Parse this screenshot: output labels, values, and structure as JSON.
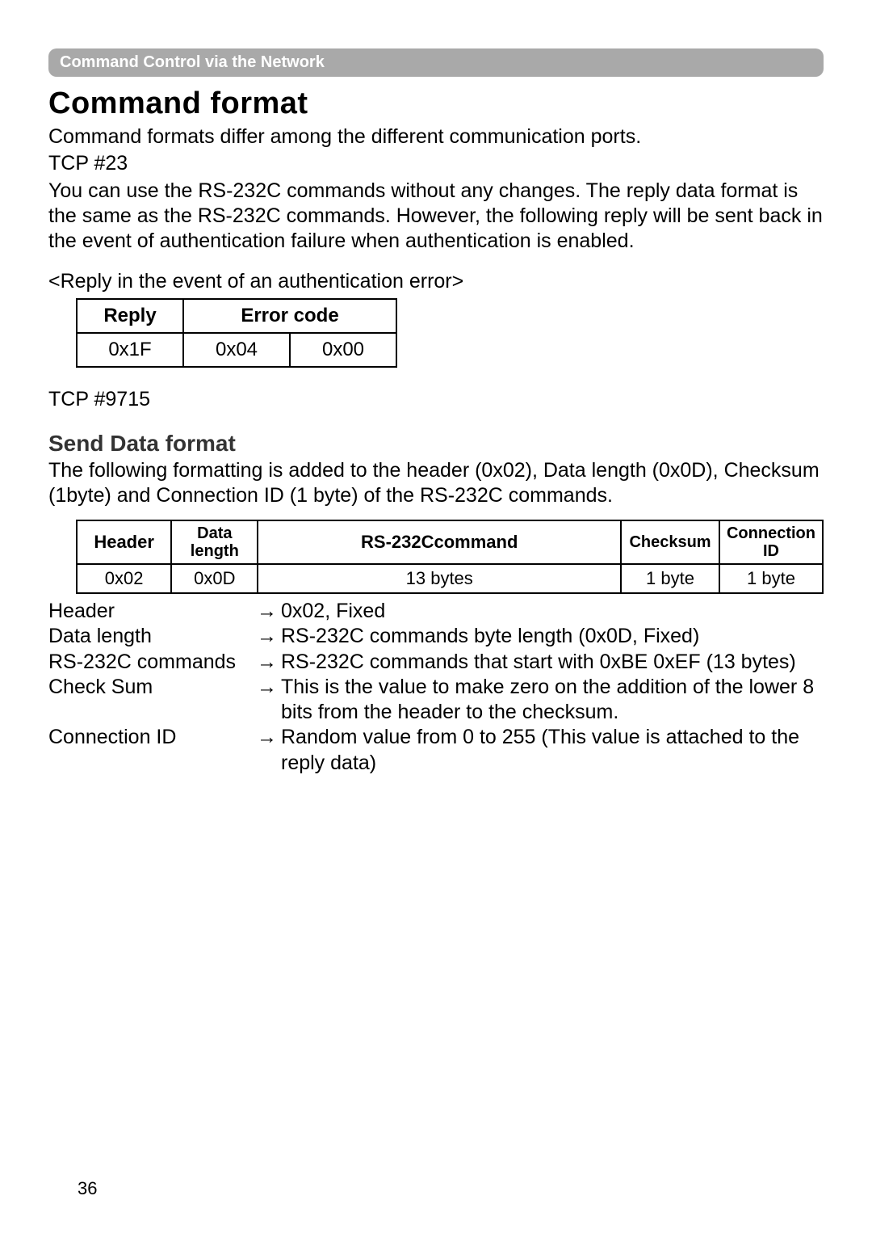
{
  "breadcrumb": "Command Control via the Network",
  "h1": "Command format",
  "intro1": "Command formats differ among the different communication ports.",
  "tcp23": "TCP #23",
  "intro2": "You can use the RS-232C commands without any changes. The reply data format is the same as the RS-232C commands. However, the following reply will be sent back in the event of authentication failure when authentication is enabled.",
  "caption_auth": "<Reply in the event of an authentication error>",
  "table1": {
    "h_reply": "Reply",
    "h_error": "Error code",
    "v_reply": "0x1F",
    "v_err1": "0x04",
    "v_err2": "0x00"
  },
  "tcp9715": "TCP #9715",
  "h2": "Send Data format",
  "senddesc": "The following formatting is added to the header (0x02), Data length (0x0D), Checksum (1byte) and Connection ID (1 byte) of the RS-232C commands.",
  "table2": {
    "h_header": "Header",
    "h_datalen": "Data length",
    "h_cmd": "RS-232Ccommand",
    "h_checksum": "Checksum",
    "h_conn": "Connection ID",
    "v_header": "0x02",
    "v_datalen": "0x0D",
    "v_cmd": "13 bytes",
    "v_checksum": "1 byte",
    "v_conn": "1 byte"
  },
  "defs": {
    "t1": "Header",
    "d1": "0x02, Fixed",
    "t2": "Data length",
    "d2": "RS-232C commands byte length (0x0D, Fixed)",
    "t3": "RS-232C commands",
    "d3": "RS-232C commands that start with 0xBE 0xEF (13 bytes)",
    "t4": "Check Sum",
    "d4": "This is the value to make zero on the addition of the lower 8 bits from the header to the checksum.",
    "t5": "Connection ID",
    "d5": "Random value from 0 to 255 (This value is attached to the reply data)"
  },
  "pagenum": "36",
  "arrow": "→"
}
